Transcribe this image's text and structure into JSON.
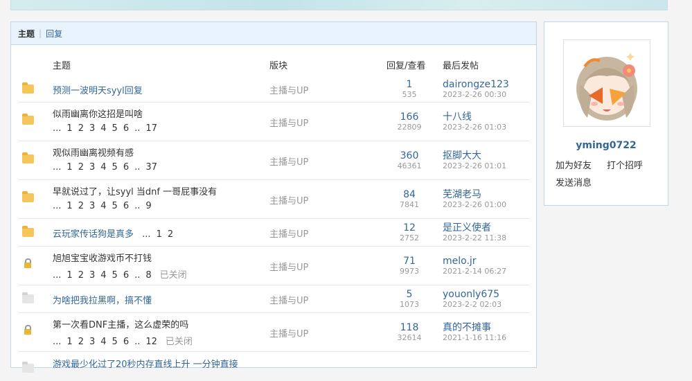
{
  "tabs": {
    "active": "主题",
    "other": "回复"
  },
  "headers": {
    "topic": "主题",
    "forum": "版块",
    "counts": "回复/查看",
    "last": "最后发帖"
  },
  "rows": [
    {
      "title": "预测一波明天syyl回复",
      "pages": [],
      "closed": "",
      "forum": "主播与UP",
      "replies": "1",
      "views": "535",
      "last_user": "dairongze123",
      "last_time": "2023-2-26 00:30",
      "icon": "folder-icon"
    },
    {
      "title": "似雨幽离你这招是叫啥",
      "pages": [
        "...",
        "1",
        "2",
        "3",
        "4",
        "5",
        "6",
        "..",
        "17"
      ],
      "closed": "",
      "forum": "主播与UP",
      "replies": "166",
      "views": "22809",
      "last_user": "十八线",
      "last_time": "2023-2-26 01:03",
      "icon": "folder-icon"
    },
    {
      "title": "观似雨幽离视频有感",
      "pages": [
        "...",
        "1",
        "2",
        "3",
        "4",
        "5",
        "6",
        "..",
        "37"
      ],
      "closed": "",
      "forum": "主播与UP",
      "replies": "360",
      "views": "46361",
      "last_user": "抠脚大大",
      "last_time": "2023-2-26 01:01",
      "icon": "folder-icon"
    },
    {
      "title": "早就说过了，让syyl 当dnf 一哥屁事没有",
      "pages": [
        "...",
        "1",
        "2",
        "3",
        "4",
        "5",
        "6",
        "..",
        "9"
      ],
      "closed": "",
      "forum": "主播与UP",
      "replies": "84",
      "views": "7841",
      "last_user": "芜湖老马",
      "last_time": "2023-2-26 01:00",
      "icon": "folder-icon"
    },
    {
      "title": "云玩家传话狗是真多",
      "pages": [
        "...",
        "1",
        "2"
      ],
      "closed": "",
      "forum": "主播与UP",
      "replies": "12",
      "views": "2752",
      "last_user": "是正义使者",
      "last_time": "2023-2-22 11:38",
      "icon": "folder-icon"
    },
    {
      "title": "旭旭宝宝收游戏币不打钱",
      "pages": [
        "...",
        "1",
        "2",
        "3",
        "4",
        "5",
        "6",
        "..",
        "8"
      ],
      "closed": "已关闭",
      "forum": "主播与UP",
      "replies": "71",
      "views": "9973",
      "last_user": "melo.jr",
      "last_time": "2021-2-14 06:27",
      "icon": "lock-icon"
    },
    {
      "title": "为啥把我拉黑啊，搞不懂",
      "pages": [],
      "closed": "",
      "forum": "主播与UP",
      "replies": "5",
      "views": "1073",
      "last_user": "youonly675",
      "last_time": "2023-2-2 02:03",
      "icon": "folder-grey-icon"
    },
    {
      "title": "第一次看DNF主播，这么虚荣的吗",
      "pages": [
        "...",
        "1",
        "2",
        "3",
        "4",
        "5",
        "6",
        "..",
        "12"
      ],
      "closed": "已关闭",
      "forum": "主播与UP",
      "replies": "118",
      "views": "32614",
      "last_user": "真的不摊事",
      "last_time": "2021-1-16 11:16",
      "icon": "lock-icon"
    }
  ],
  "partial_row_title": "游戏最少化过了20秒内存直线上升 一分钟直接",
  "profile": {
    "username": "yming0722",
    "add_friend": "加为好友",
    "greet": "打个招呼",
    "message": "发送消息"
  }
}
